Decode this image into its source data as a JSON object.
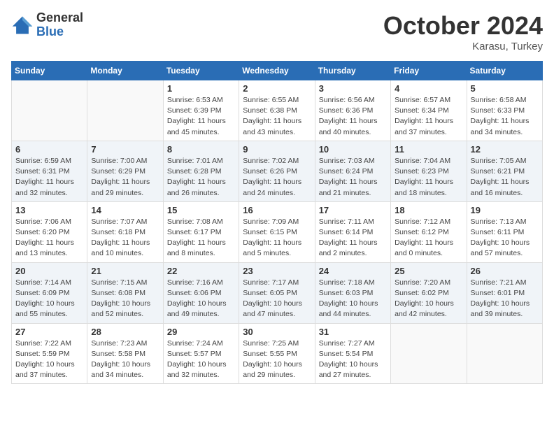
{
  "header": {
    "logo_general": "General",
    "logo_blue": "Blue",
    "month_title": "October 2024",
    "location": "Karasu, Turkey"
  },
  "days_of_week": [
    "Sunday",
    "Monday",
    "Tuesday",
    "Wednesday",
    "Thursday",
    "Friday",
    "Saturday"
  ],
  "weeks": [
    [
      {
        "day": "",
        "info": ""
      },
      {
        "day": "",
        "info": ""
      },
      {
        "day": "1",
        "info": "Sunrise: 6:53 AM\nSunset: 6:39 PM\nDaylight: 11 hours and 45 minutes."
      },
      {
        "day": "2",
        "info": "Sunrise: 6:55 AM\nSunset: 6:38 PM\nDaylight: 11 hours and 43 minutes."
      },
      {
        "day": "3",
        "info": "Sunrise: 6:56 AM\nSunset: 6:36 PM\nDaylight: 11 hours and 40 minutes."
      },
      {
        "day": "4",
        "info": "Sunrise: 6:57 AM\nSunset: 6:34 PM\nDaylight: 11 hours and 37 minutes."
      },
      {
        "day": "5",
        "info": "Sunrise: 6:58 AM\nSunset: 6:33 PM\nDaylight: 11 hours and 34 minutes."
      }
    ],
    [
      {
        "day": "6",
        "info": "Sunrise: 6:59 AM\nSunset: 6:31 PM\nDaylight: 11 hours and 32 minutes."
      },
      {
        "day": "7",
        "info": "Sunrise: 7:00 AM\nSunset: 6:29 PM\nDaylight: 11 hours and 29 minutes."
      },
      {
        "day": "8",
        "info": "Sunrise: 7:01 AM\nSunset: 6:28 PM\nDaylight: 11 hours and 26 minutes."
      },
      {
        "day": "9",
        "info": "Sunrise: 7:02 AM\nSunset: 6:26 PM\nDaylight: 11 hours and 24 minutes."
      },
      {
        "day": "10",
        "info": "Sunrise: 7:03 AM\nSunset: 6:24 PM\nDaylight: 11 hours and 21 minutes."
      },
      {
        "day": "11",
        "info": "Sunrise: 7:04 AM\nSunset: 6:23 PM\nDaylight: 11 hours and 18 minutes."
      },
      {
        "day": "12",
        "info": "Sunrise: 7:05 AM\nSunset: 6:21 PM\nDaylight: 11 hours and 16 minutes."
      }
    ],
    [
      {
        "day": "13",
        "info": "Sunrise: 7:06 AM\nSunset: 6:20 PM\nDaylight: 11 hours and 13 minutes."
      },
      {
        "day": "14",
        "info": "Sunrise: 7:07 AM\nSunset: 6:18 PM\nDaylight: 11 hours and 10 minutes."
      },
      {
        "day": "15",
        "info": "Sunrise: 7:08 AM\nSunset: 6:17 PM\nDaylight: 11 hours and 8 minutes."
      },
      {
        "day": "16",
        "info": "Sunrise: 7:09 AM\nSunset: 6:15 PM\nDaylight: 11 hours and 5 minutes."
      },
      {
        "day": "17",
        "info": "Sunrise: 7:11 AM\nSunset: 6:14 PM\nDaylight: 11 hours and 2 minutes."
      },
      {
        "day": "18",
        "info": "Sunrise: 7:12 AM\nSunset: 6:12 PM\nDaylight: 11 hours and 0 minutes."
      },
      {
        "day": "19",
        "info": "Sunrise: 7:13 AM\nSunset: 6:11 PM\nDaylight: 10 hours and 57 minutes."
      }
    ],
    [
      {
        "day": "20",
        "info": "Sunrise: 7:14 AM\nSunset: 6:09 PM\nDaylight: 10 hours and 55 minutes."
      },
      {
        "day": "21",
        "info": "Sunrise: 7:15 AM\nSunset: 6:08 PM\nDaylight: 10 hours and 52 minutes."
      },
      {
        "day": "22",
        "info": "Sunrise: 7:16 AM\nSunset: 6:06 PM\nDaylight: 10 hours and 49 minutes."
      },
      {
        "day": "23",
        "info": "Sunrise: 7:17 AM\nSunset: 6:05 PM\nDaylight: 10 hours and 47 minutes."
      },
      {
        "day": "24",
        "info": "Sunrise: 7:18 AM\nSunset: 6:03 PM\nDaylight: 10 hours and 44 minutes."
      },
      {
        "day": "25",
        "info": "Sunrise: 7:20 AM\nSunset: 6:02 PM\nDaylight: 10 hours and 42 minutes."
      },
      {
        "day": "26",
        "info": "Sunrise: 7:21 AM\nSunset: 6:01 PM\nDaylight: 10 hours and 39 minutes."
      }
    ],
    [
      {
        "day": "27",
        "info": "Sunrise: 7:22 AM\nSunset: 5:59 PM\nDaylight: 10 hours and 37 minutes."
      },
      {
        "day": "28",
        "info": "Sunrise: 7:23 AM\nSunset: 5:58 PM\nDaylight: 10 hours and 34 minutes."
      },
      {
        "day": "29",
        "info": "Sunrise: 7:24 AM\nSunset: 5:57 PM\nDaylight: 10 hours and 32 minutes."
      },
      {
        "day": "30",
        "info": "Sunrise: 7:25 AM\nSunset: 5:55 PM\nDaylight: 10 hours and 29 minutes."
      },
      {
        "day": "31",
        "info": "Sunrise: 7:27 AM\nSunset: 5:54 PM\nDaylight: 10 hours and 27 minutes."
      },
      {
        "day": "",
        "info": ""
      },
      {
        "day": "",
        "info": ""
      }
    ]
  ]
}
